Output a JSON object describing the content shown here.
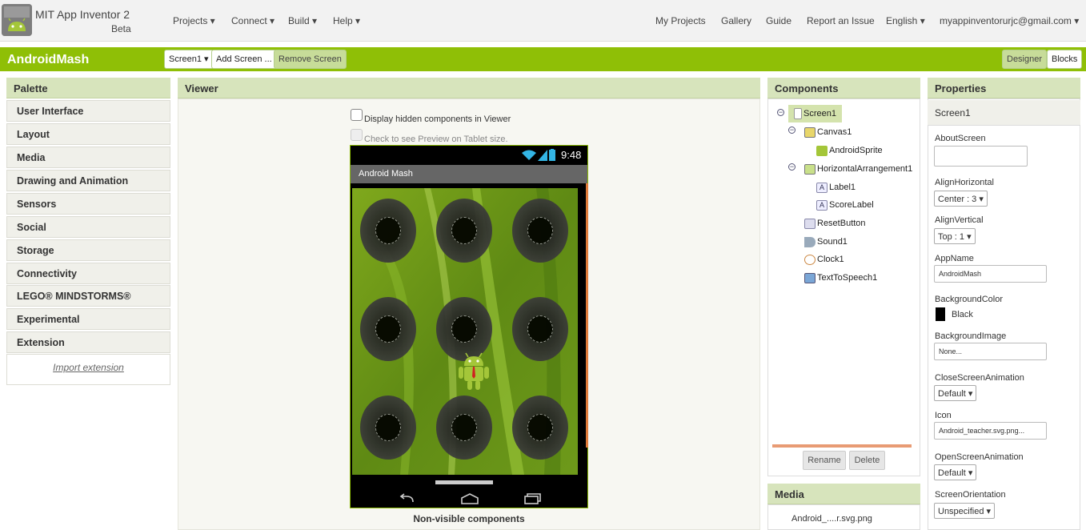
{
  "app": {
    "title": "MIT App Inventor 2",
    "beta": "Beta"
  },
  "topnav": {
    "left": [
      {
        "label": "Projects ▾"
      },
      {
        "label": "Connect ▾"
      },
      {
        "label": "Build ▾"
      },
      {
        "label": "Help ▾"
      }
    ],
    "right": [
      {
        "label": "My Projects"
      },
      {
        "label": "Gallery"
      },
      {
        "label": "Guide"
      },
      {
        "label": "Report an Issue"
      },
      {
        "label": "English ▾"
      },
      {
        "label": "myappinventorurjc@gmail.com ▾"
      }
    ]
  },
  "toolbar": {
    "project_name": "AndroidMash",
    "screen_select": "Screen1 ▾",
    "add_screen": "Add Screen ...",
    "remove_screen": "Remove Screen",
    "designer": "Designer",
    "blocks": "Blocks"
  },
  "palette": {
    "header": "Palette",
    "items": [
      "User Interface",
      "Layout",
      "Media",
      "Drawing and Animation",
      "Sensors",
      "Social",
      "Storage",
      "Connectivity",
      "LEGO® MINDSTORMS®",
      "Experimental",
      "Extension"
    ],
    "import_extension": "Import extension"
  },
  "viewer": {
    "header": "Viewer",
    "display_hidden": "Display hidden components in Viewer",
    "tablet_preview": "Check to see Preview on Tablet size.",
    "phone_time": "9:48",
    "screen_title": "Android Mash",
    "nonvisible_label": "Non-visible components"
  },
  "components": {
    "header": "Components",
    "tree": [
      "Screen1",
      "Canvas1",
      "AndroidSprite",
      "HorizontalArrangement1",
      "Label1",
      "ScoreLabel",
      "ResetButton",
      "Sound1",
      "Clock1",
      "TextToSpeech1"
    ],
    "rename": "Rename",
    "delete": "Delete"
  },
  "media": {
    "header": "Media",
    "files": [
      "Android_....r.svg.png"
    ]
  },
  "properties": {
    "header": "Properties",
    "component": "Screen1",
    "about_screen_label": "AboutScreen",
    "about_screen_value": "",
    "align_horizontal_label": "AlignHorizontal",
    "align_horizontal_value": "Center : 3 ▾",
    "align_vertical_label": "AlignVertical",
    "align_vertical_value": "Top : 1 ▾",
    "app_name_label": "AppName",
    "app_name_value": "AndroidMash",
    "background_color_label": "BackgroundColor",
    "background_color_value": "Black",
    "background_color_swatch": "#000000",
    "background_image_label": "BackgroundImage",
    "background_image_value": "None...",
    "close_anim_label": "CloseScreenAnimation",
    "close_anim_value": "Default ▾",
    "icon_label": "Icon",
    "icon_value": "Android_teacher.svg.png...",
    "open_anim_label": "OpenScreenAnimation",
    "open_anim_value": "Default ▾",
    "orientation_label": "ScreenOrientation",
    "orientation_value": "Unspecified ▾"
  },
  "colors": {
    "accent": "#8fbf06",
    "panel_header": "#d7e4bc"
  }
}
